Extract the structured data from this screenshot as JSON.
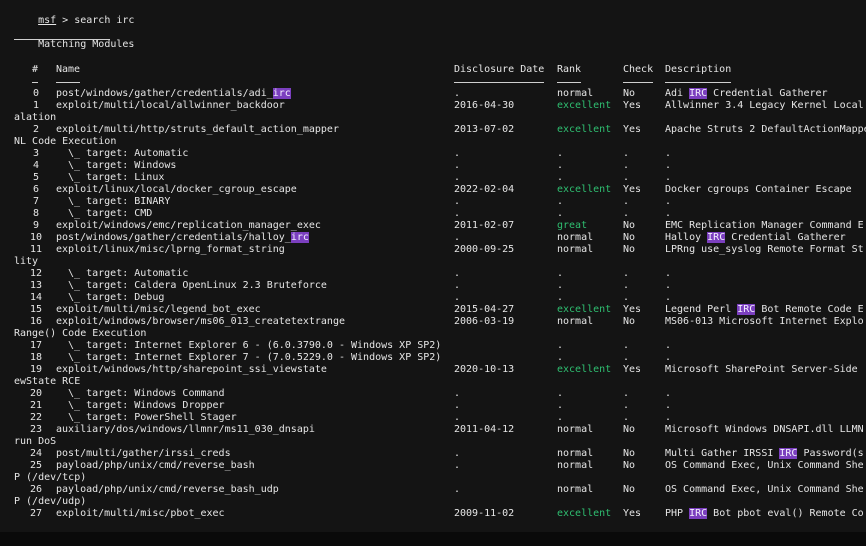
{
  "prompt": {
    "prefix": "msf",
    "sep": " > ",
    "command": "search irc"
  },
  "heading": "Matching Modules",
  "headers": {
    "num": "#",
    "name": "Name",
    "date": "Disclosure Date",
    "rank": "Rank",
    "check": "Check",
    "desc": "Description"
  },
  "rows": [
    {
      "num": "0",
      "name": "post/windows/gather/credentials/adi_",
      "name_hl": "irc",
      "name_post": "",
      "date": ".",
      "rank": "normal",
      "rank_green": false,
      "check": "No",
      "desc": "Adi ",
      "desc_hl": "IRC",
      "desc_post": " Credential Gatherer",
      "cont": ""
    },
    {
      "num": "1",
      "name": "exploit/multi/local/allwinner_backdoor",
      "name_hl": "",
      "name_post": "",
      "date": "2016-04-30",
      "rank": "excellent",
      "rank_green": true,
      "check": "Yes",
      "desc": "Allwinner 3.4 Legacy Kernel Local",
      "desc_hl": "",
      "desc_post": "",
      "cont": "alation"
    },
    {
      "num": "2",
      "name": "exploit/multi/http/struts_default_action_mapper",
      "name_hl": "",
      "name_post": "",
      "date": "2013-07-02",
      "rank": "excellent",
      "rank_green": true,
      "check": "Yes",
      "desc": "Apache Struts 2 DefaultActionMappe",
      "desc_hl": "",
      "desc_post": "",
      "cont": "NL Code Execution"
    },
    {
      "num": "3",
      "name": "  \\_ target: Automatic",
      "name_hl": "",
      "name_post": "",
      "date": ".",
      "rank": ".",
      "rank_green": false,
      "check": ".",
      "desc": ".",
      "desc_hl": "",
      "desc_post": "",
      "cont": ""
    },
    {
      "num": "4",
      "name": "  \\_ target: Windows",
      "name_hl": "",
      "name_post": "",
      "date": ".",
      "rank": ".",
      "rank_green": false,
      "check": ".",
      "desc": ".",
      "desc_hl": "",
      "desc_post": "",
      "cont": ""
    },
    {
      "num": "5",
      "name": "  \\_ target: Linux",
      "name_hl": "",
      "name_post": "",
      "date": ".",
      "rank": ".",
      "rank_green": false,
      "check": ".",
      "desc": ".",
      "desc_hl": "",
      "desc_post": "",
      "cont": ""
    },
    {
      "num": "6",
      "name": "exploit/linux/local/docker_cgroup_escape",
      "name_hl": "",
      "name_post": "",
      "date": "2022-02-04",
      "rank": "excellent",
      "rank_green": true,
      "check": "Yes",
      "desc": "Docker cgroups Container Escape",
      "desc_hl": "",
      "desc_post": "",
      "cont": ""
    },
    {
      "num": "7",
      "name": "  \\_ target: BINARY",
      "name_hl": "",
      "name_post": "",
      "date": ".",
      "rank": ".",
      "rank_green": false,
      "check": ".",
      "desc": ".",
      "desc_hl": "",
      "desc_post": "",
      "cont": ""
    },
    {
      "num": "8",
      "name": "  \\_ target: CMD",
      "name_hl": "",
      "name_post": "",
      "date": ".",
      "rank": ".",
      "rank_green": false,
      "check": ".",
      "desc": ".",
      "desc_hl": "",
      "desc_post": "",
      "cont": ""
    },
    {
      "num": "9",
      "name": "exploit/windows/emc/replication_manager_exec",
      "name_hl": "",
      "name_post": "",
      "date": "2011-02-07",
      "rank": "great",
      "rank_green": true,
      "check": "No",
      "desc": "EMC Replication Manager Command E",
      "desc_hl": "",
      "desc_post": "",
      "cont": ""
    },
    {
      "num": "10",
      "name": "post/windows/gather/credentials/halloy_",
      "name_hl": "irc",
      "name_post": "",
      "date": ".",
      "rank": "normal",
      "rank_green": false,
      "check": "No",
      "desc": "Halloy ",
      "desc_hl": "IRC",
      "desc_post": " Credential Gatherer",
      "cont": ""
    },
    {
      "num": "11",
      "name": "exploit/linux/misc/lprng_format_string",
      "name_hl": "",
      "name_post": "",
      "date": "2000-09-25",
      "rank": "normal",
      "rank_green": false,
      "check": "No",
      "desc": "LPRng use_syslog Remote Format St",
      "desc_hl": "",
      "desc_post": "",
      "cont": "lity"
    },
    {
      "num": "12",
      "name": "  \\_ target: Automatic",
      "name_hl": "",
      "name_post": "",
      "date": ".",
      "rank": ".",
      "rank_green": false,
      "check": ".",
      "desc": ".",
      "desc_hl": "",
      "desc_post": "",
      "cont": ""
    },
    {
      "num": "13",
      "name": "  \\_ target: Caldera OpenLinux 2.3 Bruteforce",
      "name_hl": "",
      "name_post": "",
      "date": ".",
      "rank": ".",
      "rank_green": false,
      "check": ".",
      "desc": ".",
      "desc_hl": "",
      "desc_post": "",
      "cont": ""
    },
    {
      "num": "14",
      "name": "  \\_ target: Debug",
      "name_hl": "",
      "name_post": "",
      "date": ".",
      "rank": ".",
      "rank_green": false,
      "check": ".",
      "desc": ".",
      "desc_hl": "",
      "desc_post": "",
      "cont": ""
    },
    {
      "num": "15",
      "name": "exploit/multi/misc/legend_bot_exec",
      "name_hl": "",
      "name_post": "",
      "date": "2015-04-27",
      "rank": "excellent",
      "rank_green": true,
      "check": "Yes",
      "desc": "Legend Perl ",
      "desc_hl": "IRC",
      "desc_post": " Bot Remote Code E",
      "cont": ""
    },
    {
      "num": "16",
      "name": "exploit/windows/browser/ms06_013_createtextrange",
      "name_hl": "",
      "name_post": "",
      "date": "2006-03-19",
      "rank": "normal",
      "rank_green": false,
      "check": "No",
      "desc": "MS06-013 Microsoft Internet Explo",
      "desc_hl": "",
      "desc_post": "",
      "cont": "Range() Code Execution"
    },
    {
      "num": "17",
      "name": "  \\_ target: Internet Explorer 6 - (6.0.3790.0 - Windows XP SP2)",
      "name_hl": "",
      "name_post": "",
      "date": "",
      "rank": ".",
      "rank_green": false,
      "check": ".",
      "desc": ".",
      "desc_hl": "",
      "desc_post": "",
      "cont": ""
    },
    {
      "num": "18",
      "name": "  \\_ target: Internet Explorer 7 - (7.0.5229.0 - Windows XP SP2)",
      "name_hl": "",
      "name_post": "",
      "date": "",
      "rank": ".",
      "rank_green": false,
      "check": ".",
      "desc": ".",
      "desc_hl": "",
      "desc_post": "",
      "cont": ""
    },
    {
      "num": "19",
      "name": "exploit/windows/http/sharepoint_ssi_viewstate",
      "name_hl": "",
      "name_post": "",
      "date": "2020-10-13",
      "rank": "excellent",
      "rank_green": true,
      "check": "Yes",
      "desc": "Microsoft SharePoint Server-Side",
      "desc_hl": "",
      "desc_post": "",
      "cont": "ewState RCE"
    },
    {
      "num": "20",
      "name": "  \\_ target: Windows Command",
      "name_hl": "",
      "name_post": "",
      "date": ".",
      "rank": ".",
      "rank_green": false,
      "check": ".",
      "desc": ".",
      "desc_hl": "",
      "desc_post": "",
      "cont": ""
    },
    {
      "num": "21",
      "name": "  \\_ target: Windows Dropper",
      "name_hl": "",
      "name_post": "",
      "date": ".",
      "rank": ".",
      "rank_green": false,
      "check": ".",
      "desc": ".",
      "desc_hl": "",
      "desc_post": "",
      "cont": ""
    },
    {
      "num": "22",
      "name": "  \\_ target: PowerShell Stager",
      "name_hl": "",
      "name_post": "",
      "date": ".",
      "rank": ".",
      "rank_green": false,
      "check": ".",
      "desc": ".",
      "desc_hl": "",
      "desc_post": "",
      "cont": ""
    },
    {
      "num": "23",
      "name": "auxiliary/dos/windows/llmnr/ms11_030_dnsapi",
      "name_hl": "",
      "name_post": "",
      "date": "2011-04-12",
      "rank": "normal",
      "rank_green": false,
      "check": "No",
      "desc": "Microsoft Windows DNSAPI.dll LLMN",
      "desc_hl": "",
      "desc_post": "",
      "cont": "run DoS"
    },
    {
      "num": "24",
      "name": "post/multi/gather/irssi_creds",
      "name_hl": "",
      "name_post": "",
      "date": ".",
      "rank": "normal",
      "rank_green": false,
      "check": "No",
      "desc": "Multi Gather IRSSI ",
      "desc_hl": "IRC",
      "desc_post": " Password(s",
      "cont": ""
    },
    {
      "num": "25",
      "name": "payload/php/unix/cmd/reverse_bash",
      "name_hl": "",
      "name_post": "",
      "date": ".",
      "rank": "normal",
      "rank_green": false,
      "check": "No",
      "desc": "OS Command Exec, Unix Command She",
      "desc_hl": "",
      "desc_post": "",
      "cont": "P (/dev/tcp)"
    },
    {
      "num": "26",
      "name": "payload/php/unix/cmd/reverse_bash_udp",
      "name_hl": "",
      "name_post": "",
      "date": ".",
      "rank": "normal",
      "rank_green": false,
      "check": "No",
      "desc": "OS Command Exec, Unix Command She",
      "desc_hl": "",
      "desc_post": "",
      "cont": "P (/dev/udp)"
    },
    {
      "num": "27",
      "name": "exploit/multi/misc/pbot_exec",
      "name_hl": "",
      "name_post": "",
      "date": "2009-11-02",
      "rank": "excellent",
      "rank_green": true,
      "check": "Yes",
      "desc": "PHP ",
      "desc_hl": "IRC",
      "desc_post": " Bot pbot eval() Remote Co",
      "cont": ""
    }
  ],
  "colors": {
    "background": "#141414",
    "text": "#e6e6e6",
    "green": "#2fbf71",
    "highlight": "#7b3fbf"
  }
}
